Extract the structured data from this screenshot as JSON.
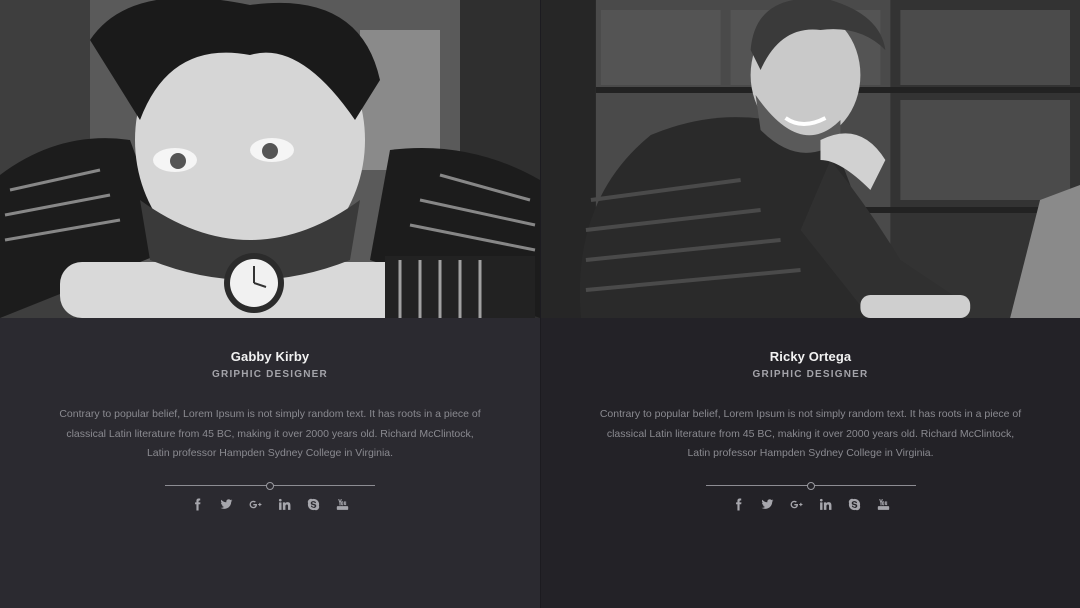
{
  "members": [
    {
      "name": "Gabby Kirby",
      "role": "GRIPHIC DESIGNER",
      "bio": "Contrary to popular belief, Lorem Ipsum is not simply random text. It has roots in a piece of classical Latin literature from 45 BC, making it over 2000 years old. Richard McClintock, Latin professor Hampden Sydney College in Virginia.",
      "socials": [
        "facebook-icon",
        "twitter-icon",
        "google-plus-icon",
        "linkedin-icon",
        "skype-icon",
        "youtube-icon"
      ]
    },
    {
      "name": "Ricky Ortega",
      "role": "GRIPHIC DESIGNER",
      "bio": "Contrary to popular belief, Lorem Ipsum is not simply random text. It has roots in a piece of classical Latin literature from 45 BC, making it over 2000 years old. Richard McClintock, Latin professor Hampden Sydney College in Virginia.",
      "socials": [
        "facebook-icon",
        "twitter-icon",
        "google-plus-icon",
        "linkedin-icon",
        "skype-icon",
        "youtube-icon"
      ]
    }
  ],
  "colors": {
    "left_panel": "#2b2a30",
    "right_panel": "#232227",
    "name": "#f2f2f2",
    "role": "#a4a4aa",
    "text": "#8a8a90",
    "icon": "#a6a6ac"
  }
}
